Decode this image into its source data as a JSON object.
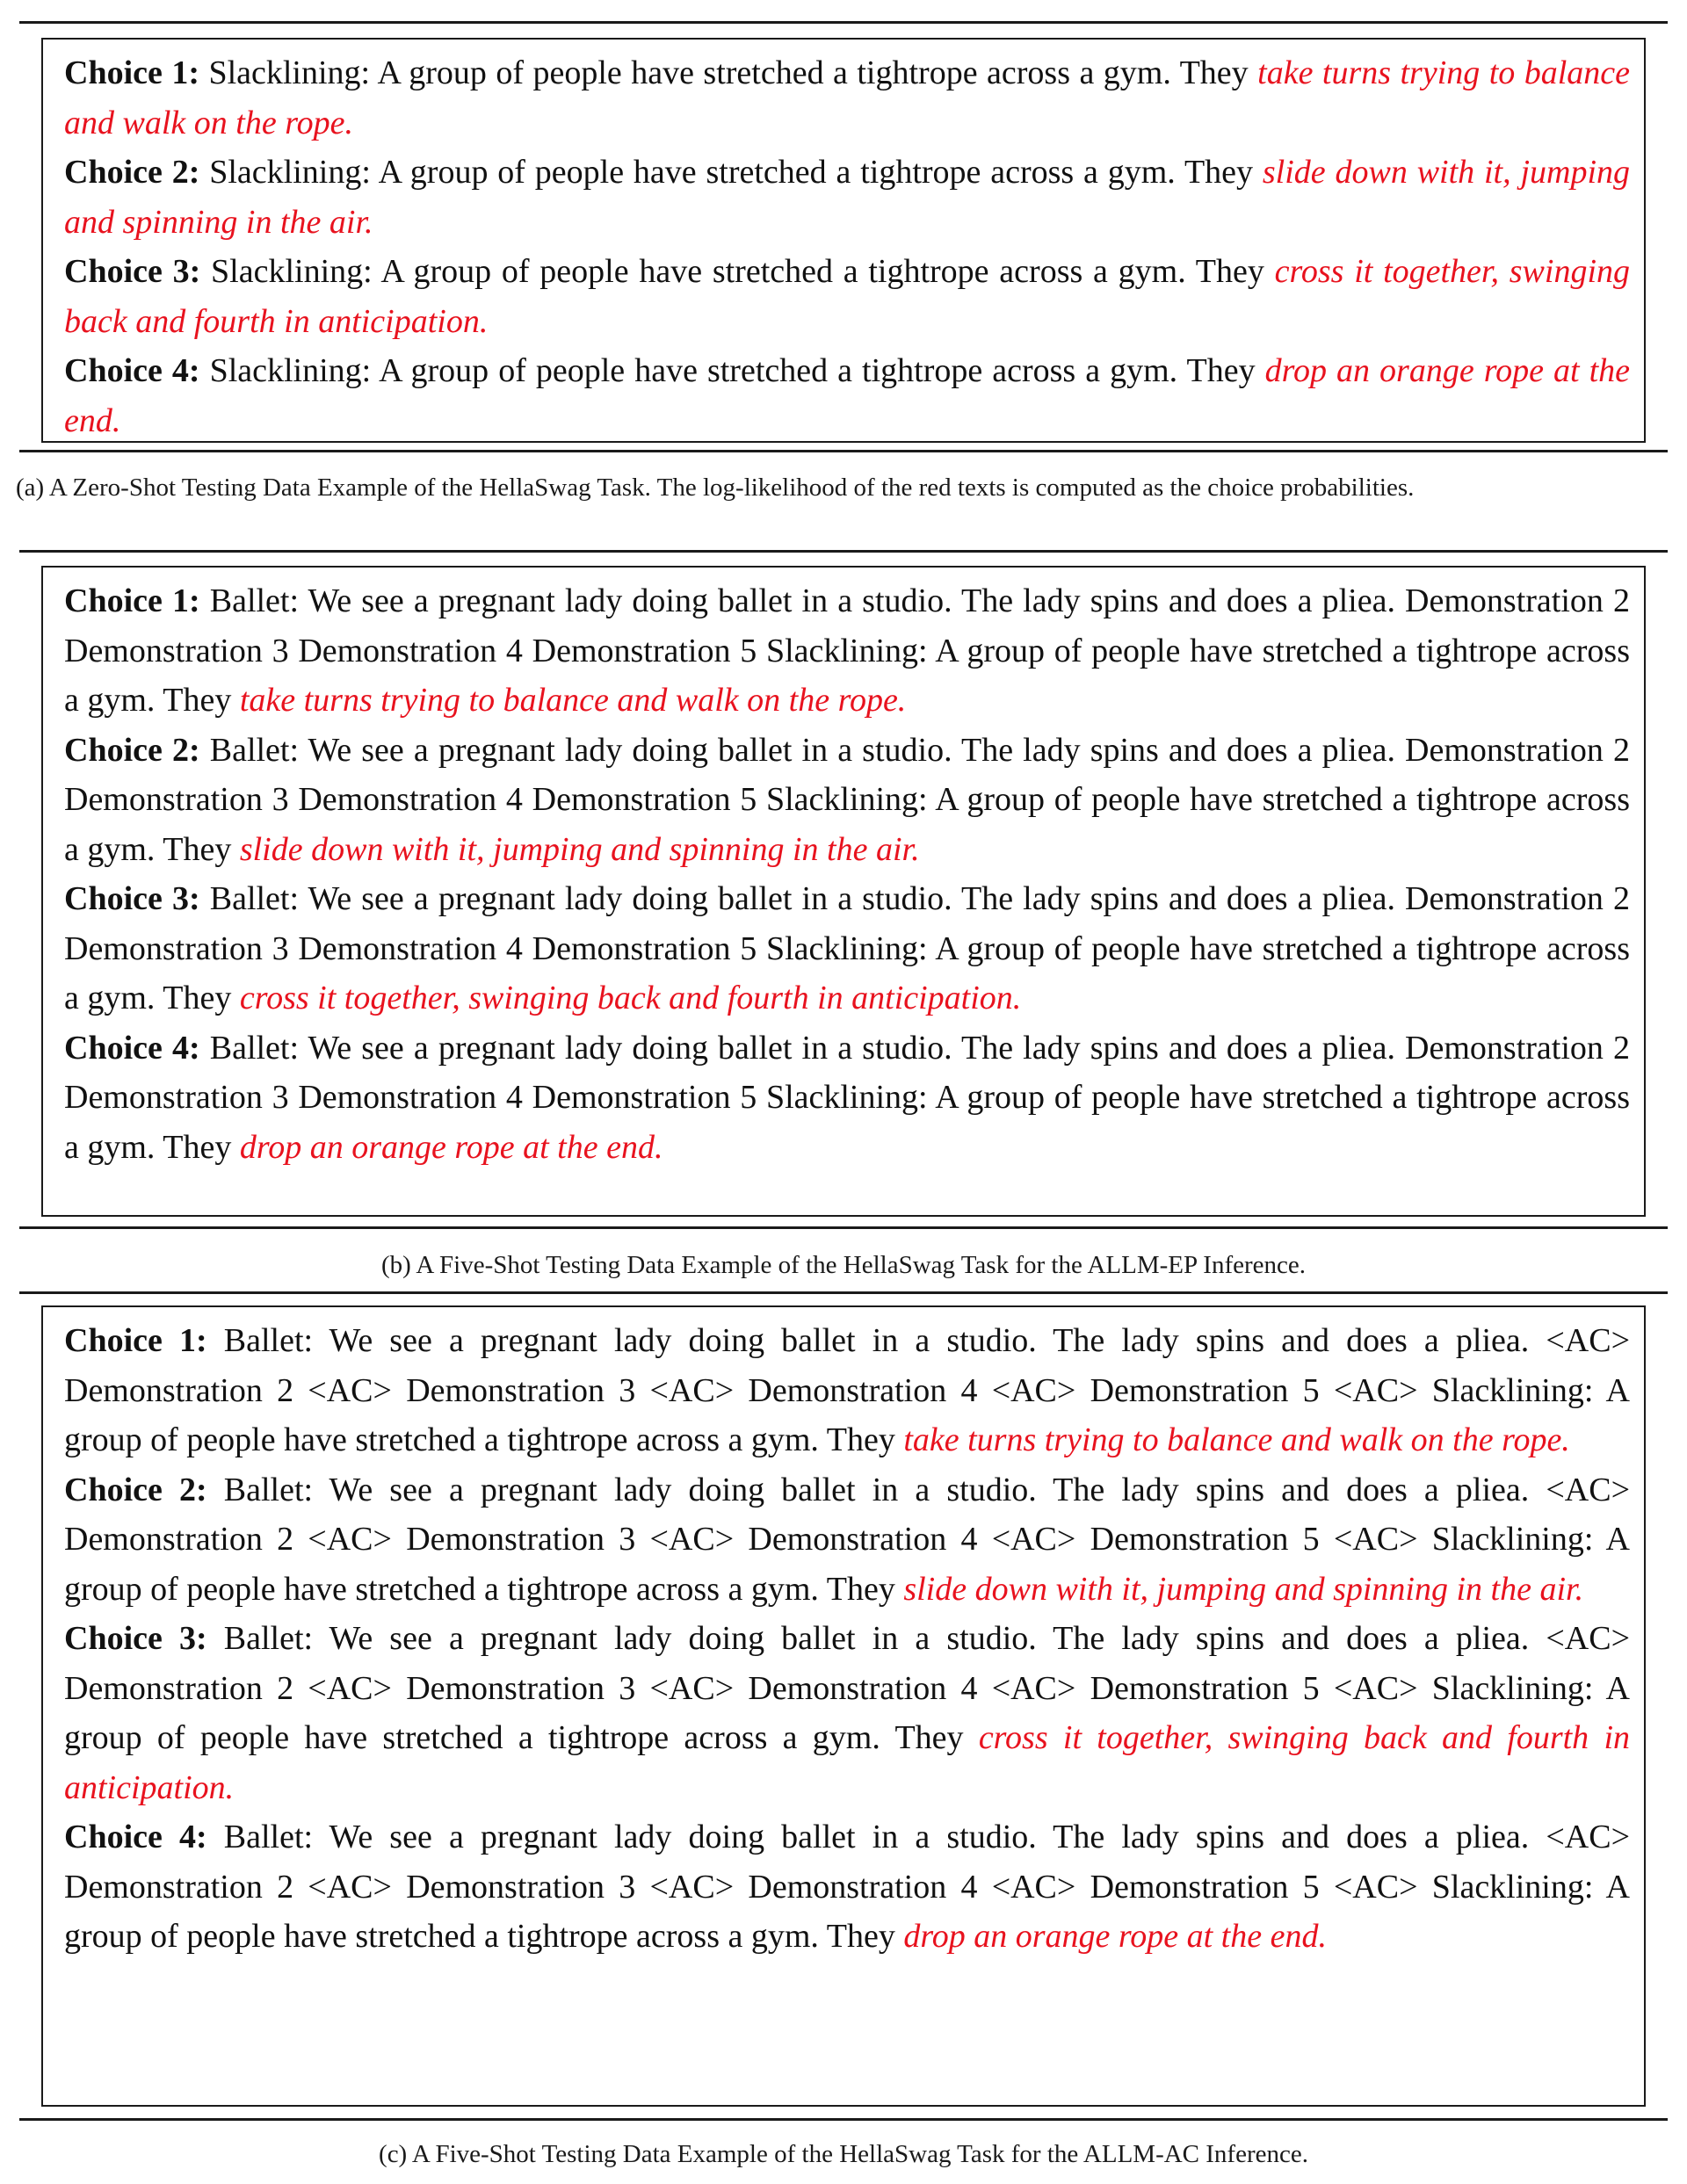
{
  "panels": [
    {
      "id": "a",
      "caption": "(a) A Zero-Shot Testing Data Example of the HellaSwag Task. The log-likelihood of the red texts is computed as the choice probabilities.",
      "choices": [
        {
          "label": "Choice 1:",
          "context": "Slacklining: A group of people have stretched a tightrope across a gym. They",
          "ending": "take turns trying to balance and walk on the rope."
        },
        {
          "label": "Choice 2:",
          "context": "Slacklining: A group of people have stretched a tightrope across a gym. They",
          "ending": "slide down with it, jumping and spinning in the air."
        },
        {
          "label": "Choice 3:",
          "context": "Slacklining: A group of people have stretched a tightrope across a gym. They",
          "ending": "cross it together, swinging back and fourth in anticipation."
        },
        {
          "label": "Choice 4:",
          "context": "Slacklining: A group of people have stretched a tightrope across a gym. They",
          "ending": "drop an orange rope at the end."
        }
      ]
    },
    {
      "id": "b",
      "caption": "(b) A Five-Shot Testing Data Example of the HellaSwag Task for the ALLM-EP Inference.",
      "choices": [
        {
          "label": "Choice 1:",
          "context": "Ballet: We see a pregnant lady doing ballet in a studio. The lady spins and does a pliea. Demonstration 2 Demonstration 3 Demonstration 4 Demonstration 5 Slacklining: A group of people have stretched a tightrope across a gym. They",
          "ending": "take turns trying to balance and walk on the rope."
        },
        {
          "label": "Choice 2:",
          "context": "Ballet: We see a pregnant lady doing ballet in a studio. The lady spins and does a pliea. Demonstration 2 Demonstration 3 Demonstration 4 Demonstration 5 Slacklining: A group of people have stretched a tightrope across a gym. They",
          "ending": "slide down with it, jumping and spinning in the air."
        },
        {
          "label": "Choice 3:",
          "context": "Ballet: We see a pregnant lady doing ballet in a studio. The lady spins and does a pliea. Demonstration 2 Demonstration 3 Demonstration 4 Demonstration 5 Slacklining: A group of people have stretched a tightrope across a gym. They",
          "ending": "cross it together, swinging back and fourth in anticipation."
        },
        {
          "label": "Choice 4:",
          "context": "Ballet: We see a pregnant lady doing ballet in a studio. The lady spins and does a pliea. Demonstration 2 Demonstration 3 Demonstration 4 Demonstration 5 Slacklining: A group of people have stretched a tightrope across a gym. They",
          "ending": "drop an orange rope at the end."
        }
      ]
    },
    {
      "id": "c",
      "caption": "(c) A Five-Shot Testing Data Example of the HellaSwag Task for the ALLM-AC Inference.",
      "choices": [
        {
          "label": "Choice 1:",
          "context": "Ballet: We see a pregnant lady doing ballet in a studio. The lady spins and does a pliea. <AC> Demonstration 2 <AC> Demonstration 3 <AC> Demonstration 4 <AC> Demonstration 5 <AC> Slacklining: A group of people have stretched a tightrope across a gym. They",
          "ending": "take turns trying to balance and walk on the rope."
        },
        {
          "label": "Choice 2:",
          "context": "Ballet: We see a pregnant lady doing ballet in a studio. The lady spins and does a pliea. <AC> Demonstration 2 <AC> Demonstration 3 <AC> Demonstration 4 <AC> Demonstration 5 <AC> Slacklining: A group of people have stretched a tightrope across a gym. They",
          "ending": "slide down with it, jumping and spinning in the air."
        },
        {
          "label": "Choice 3:",
          "context": "Ballet: We see a pregnant lady doing ballet in a studio. The lady spins and does a pliea. <AC> Demonstration 2 <AC> Demonstration 3 <AC> Demonstration 4 <AC> Demonstration 5 <AC> Slacklining: A group of people have stretched a tightrope across a gym. They",
          "ending": "cross it together, swinging back and fourth in anticipation."
        },
        {
          "label": "Choice 4:",
          "context": "Ballet: We see a pregnant lady doing ballet in a studio. The lady spins and does a pliea. <AC> Demonstration 2 <AC> Demonstration 3 <AC> Demonstration 4 <AC> Demonstration 5 <AC> Slacklining: A group of people have stretched a tightrope across a gym. They",
          "ending": "drop an orange rope at the end."
        }
      ]
    }
  ],
  "colors": {
    "ending_text": "#e8121e",
    "body_text": "#111111",
    "rule": "#1a1a1a"
  }
}
